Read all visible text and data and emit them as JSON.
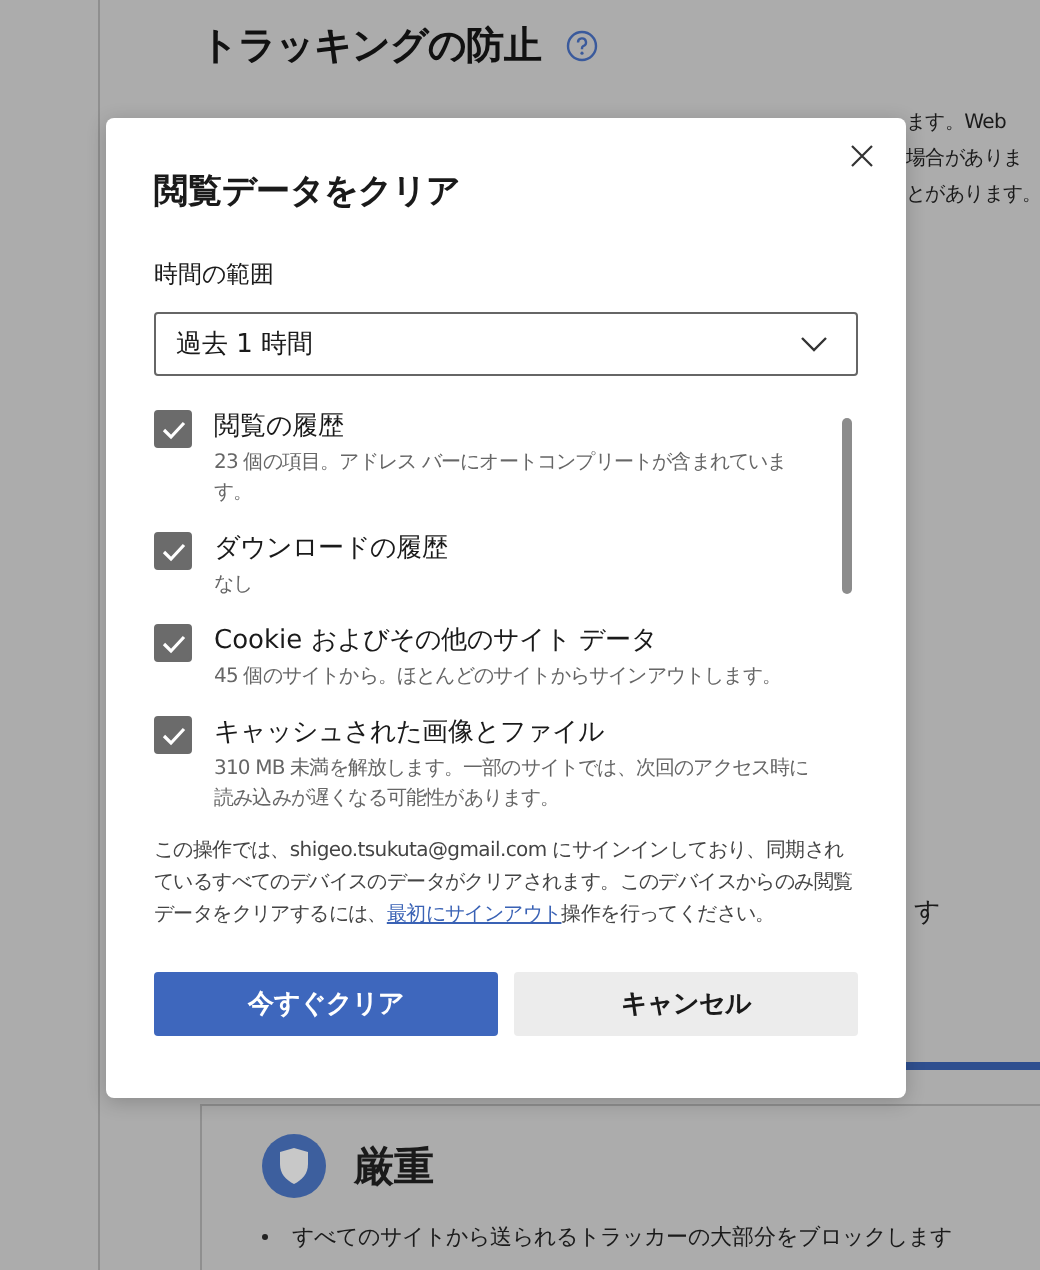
{
  "background": {
    "heading": "トラッキングの防止",
    "text_fragments": [
      "ます。Web",
      "場合がありま",
      "とがあります。"
    ],
    "lower_fragment": "す",
    "strict_card": {
      "title": "厳重",
      "bullet": "すべてのサイトから送られるトラッカーの大部分をブロックします"
    }
  },
  "dialog": {
    "title": "閲覧データをクリア",
    "time_range_label": "時間の範囲",
    "time_range_value": "過去 1 時間",
    "items": [
      {
        "label": "閲覧の履歴",
        "description": "23 個の項目。アドレス バーにオートコンプリートが含まれています。",
        "checked": true
      },
      {
        "label": "ダウンロードの履歴",
        "description": "なし",
        "checked": true
      },
      {
        "label": "Cookie およびその他のサイト データ",
        "description": "45 個のサイトから。ほとんどのサイトからサインアウトします。",
        "checked": true
      },
      {
        "label": "キャッシュされた画像とファイル",
        "description": "310 MB 未満を解放します。一部のサイトでは、次回のアクセス時に読み込みが遅くなる可能性があります。",
        "checked": true
      }
    ],
    "notice_before": "この操作では、shigeo.tsukuta@gmail.com にサインインしており、同期されているすべてのデバイスのデータがクリアされます。このデバイスからのみ閲覧データをクリアするには、",
    "notice_link": "最初にサインアウト",
    "notice_after": "操作を行ってください。",
    "buttons": [
      {
        "label": "今すぐクリア",
        "kind": "primary"
      },
      {
        "label": "キャンセル",
        "kind": "secondary"
      }
    ]
  }
}
